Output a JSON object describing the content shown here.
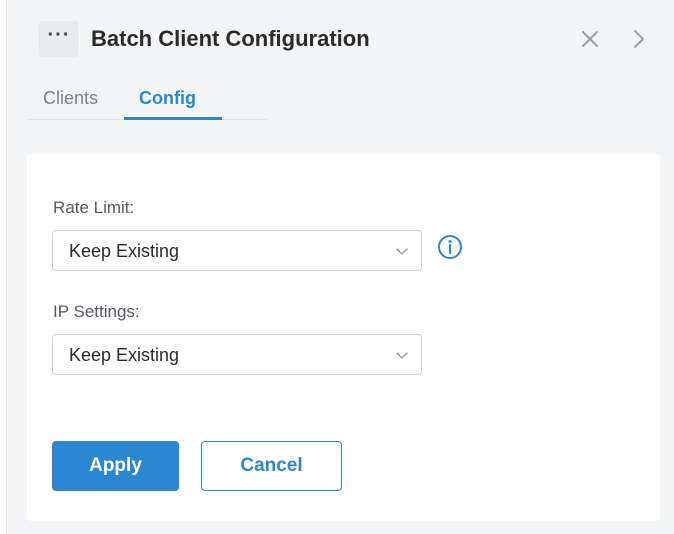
{
  "header": {
    "more_glyph": "···",
    "title": "Batch Client Configuration"
  },
  "tabs": [
    {
      "label": "Clients",
      "active": false
    },
    {
      "label": "Config",
      "active": true
    }
  ],
  "form": {
    "rate_limit": {
      "label": "Rate Limit:",
      "value": "Keep Existing"
    },
    "ip_settings": {
      "label": "IP Settings:",
      "value": "Keep Existing"
    }
  },
  "buttons": {
    "apply": "Apply",
    "cancel": "Cancel"
  },
  "icons": {
    "more": "more-horizontal-icon",
    "close": "close-icon",
    "next": "chevron-right-icon",
    "info": "info-icon",
    "dropdown": "chevron-down-icon"
  },
  "colors": {
    "accent": "#2b87d1",
    "panel_bg": "#f4f5f7",
    "card_bg": "#ffffff"
  }
}
